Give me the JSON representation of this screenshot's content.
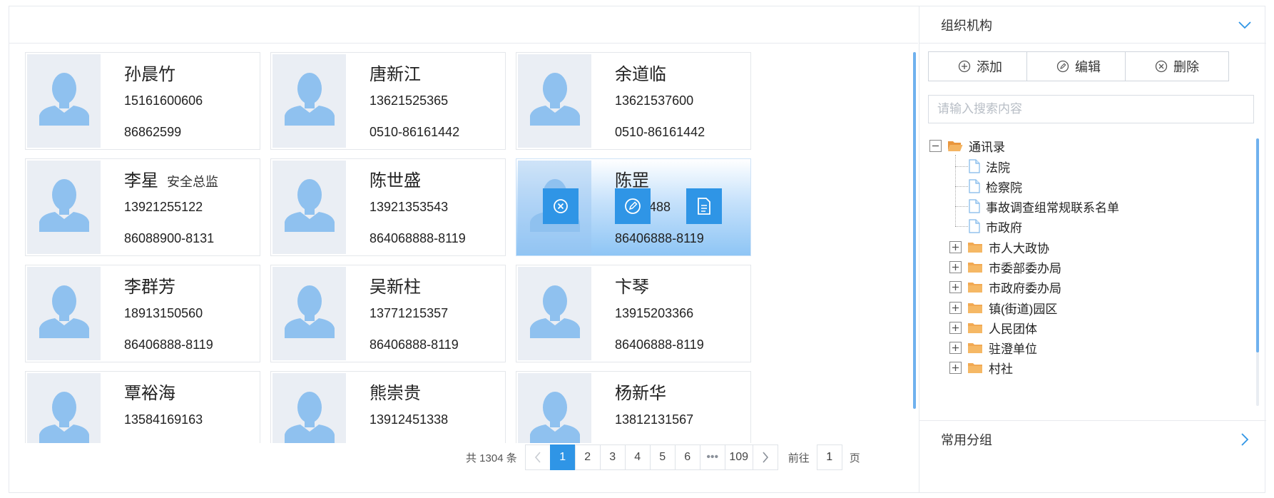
{
  "contacts": [
    {
      "name": "孙晨竹",
      "title": "",
      "mobile": "15161600606",
      "tel": "86862599"
    },
    {
      "name": "唐新江",
      "title": "",
      "mobile": "13621525365",
      "tel": "0510-86161442"
    },
    {
      "name": "余道临",
      "title": "",
      "mobile": "13621537600",
      "tel": "0510-86161442"
    },
    {
      "name": "李星",
      "title": "安全总监",
      "mobile": "13921255122",
      "tel": "86088900-8131"
    },
    {
      "name": "陈世盛",
      "title": "",
      "mobile": "13921353543",
      "tel": "864068888-8119"
    },
    {
      "name": "陈罡",
      "title": "",
      "mobile": "…248488",
      "tel": "86406888-8119"
    },
    {
      "name": "李群芳",
      "title": "",
      "mobile": "18913150560",
      "tel": "86406888-8119"
    },
    {
      "name": "吴新柱",
      "title": "",
      "mobile": "13771215357",
      "tel": "86406888-8119"
    },
    {
      "name": "卞琴",
      "title": "",
      "mobile": "13915203366",
      "tel": "86406888-8119"
    },
    {
      "name": "覃裕海",
      "title": "",
      "mobile": "13584169163",
      "tel": ""
    },
    {
      "name": "熊崇贵",
      "title": "",
      "mobile": "13912451338",
      "tel": ""
    },
    {
      "name": "杨新华",
      "title": "",
      "mobile": "13812131567",
      "tel": ""
    }
  ],
  "pagination": {
    "total": "共 1304 条",
    "pages": [
      "1",
      "2",
      "3",
      "4",
      "5",
      "6",
      "•••",
      "109"
    ],
    "current": "1",
    "goto_label": "前往",
    "goto_value": "1",
    "page_suffix": "页"
  },
  "sidebar": {
    "org_title": "组织机构",
    "buttons": {
      "add": "添加",
      "edit": "编辑",
      "delete": "删除"
    },
    "search_placeholder": "请输入搜索内容",
    "tree": {
      "root": "通讯录",
      "docs": [
        "法院",
        "检察院",
        "事故调查组常规联系名单",
        "市政府"
      ],
      "folders": [
        "市人大政协",
        "市委部委办局",
        "市政府委办局",
        "镇(街道)园区",
        "人民团体",
        "驻澄单位"
      ],
      "partial": "村社"
    },
    "common_groups_title": "常用分组"
  },
  "colors": {
    "accent": "#2f95e6",
    "folder": "#f2a953",
    "avatar": "#8fc1ef"
  }
}
